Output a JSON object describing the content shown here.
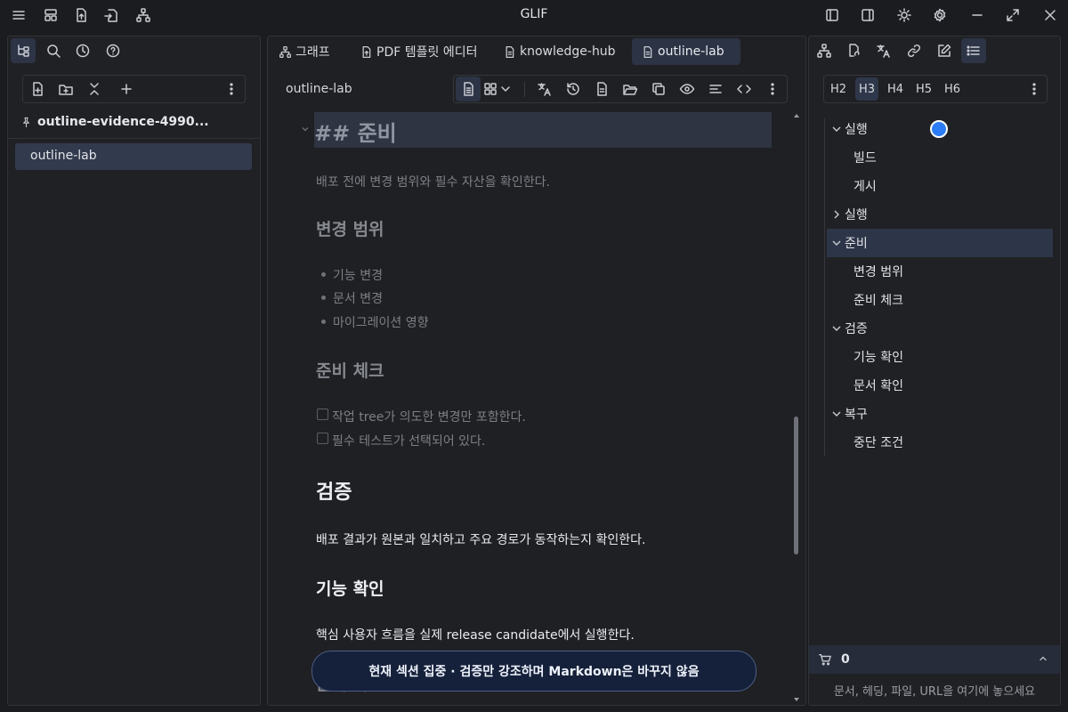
{
  "app": {
    "title": "GLIF"
  },
  "left_panel": {
    "vault_name": "outline-evidence-4990...",
    "files": [
      "outline-lab"
    ]
  },
  "tabs": [
    {
      "label": "그래프",
      "icon": "graph-icon"
    },
    {
      "label": "PDF 템플릿 에디터",
      "icon": "file-export-icon"
    },
    {
      "label": "knowledge-hub",
      "icon": "document-icon"
    },
    {
      "label": "outline-lab",
      "icon": "document-icon",
      "active": true
    }
  ],
  "editor": {
    "doc_title": "outline-lab",
    "h2_source": "## 준비",
    "prep_paragraph": "배포 전에 변경 범위와 필수 자산을 확인한다.",
    "h_change_scope": "변경 범위",
    "bullets": [
      "기능 변경",
      "문서 변경",
      "마이그레이션 영향"
    ],
    "h_prep_check": "준비 체크",
    "checkboxes": [
      "작업 tree가 의도한 변경만 포함한다.",
      "필수 테스트가 선택되어 있다."
    ],
    "h_verify": "검증",
    "verify_paragraph": "배포 결과가 원본과 일치하고 주요 경로가 동작하는지 확인한다.",
    "h_feature_check": "기능 확인",
    "feature_paragraph": "핵심 사용자 흐름을 실제 release candidate에서 실행한다.",
    "h_doc_check_partial": "문서 확인"
  },
  "focus_banner": "현재 섹션 집중 · 검증만 강조하며 Markdown은 바꾸지 않음",
  "outline": {
    "heading_levels": [
      "H2",
      "H3",
      "H4",
      "H5",
      "H6"
    ],
    "active_level": "H3",
    "items": [
      {
        "label": "실행",
        "level": 1,
        "expanded": true
      },
      {
        "label": "빌드",
        "level": 2
      },
      {
        "label": "게시",
        "level": 2
      },
      {
        "label": "실행",
        "level": 1,
        "expanded": false
      },
      {
        "label": "준비",
        "level": 1,
        "expanded": true,
        "selected": true
      },
      {
        "label": "변경 범위",
        "level": 2
      },
      {
        "label": "준비 체크",
        "level": 2
      },
      {
        "label": "검증",
        "level": 1,
        "expanded": true
      },
      {
        "label": "기능 확인",
        "level": 2
      },
      {
        "label": "문서 확인",
        "level": 2
      },
      {
        "label": "복구",
        "level": 1,
        "expanded": true
      },
      {
        "label": "중단 조건",
        "level": 2
      }
    ]
  },
  "basket": {
    "count": "0",
    "drop_hint": "문서, 헤딩, 파일, URL을 여기에 놓으세요"
  },
  "colors": {
    "accent": "#2b7cf6",
    "selection": "#2d3548",
    "background": "#1b1c1f"
  }
}
